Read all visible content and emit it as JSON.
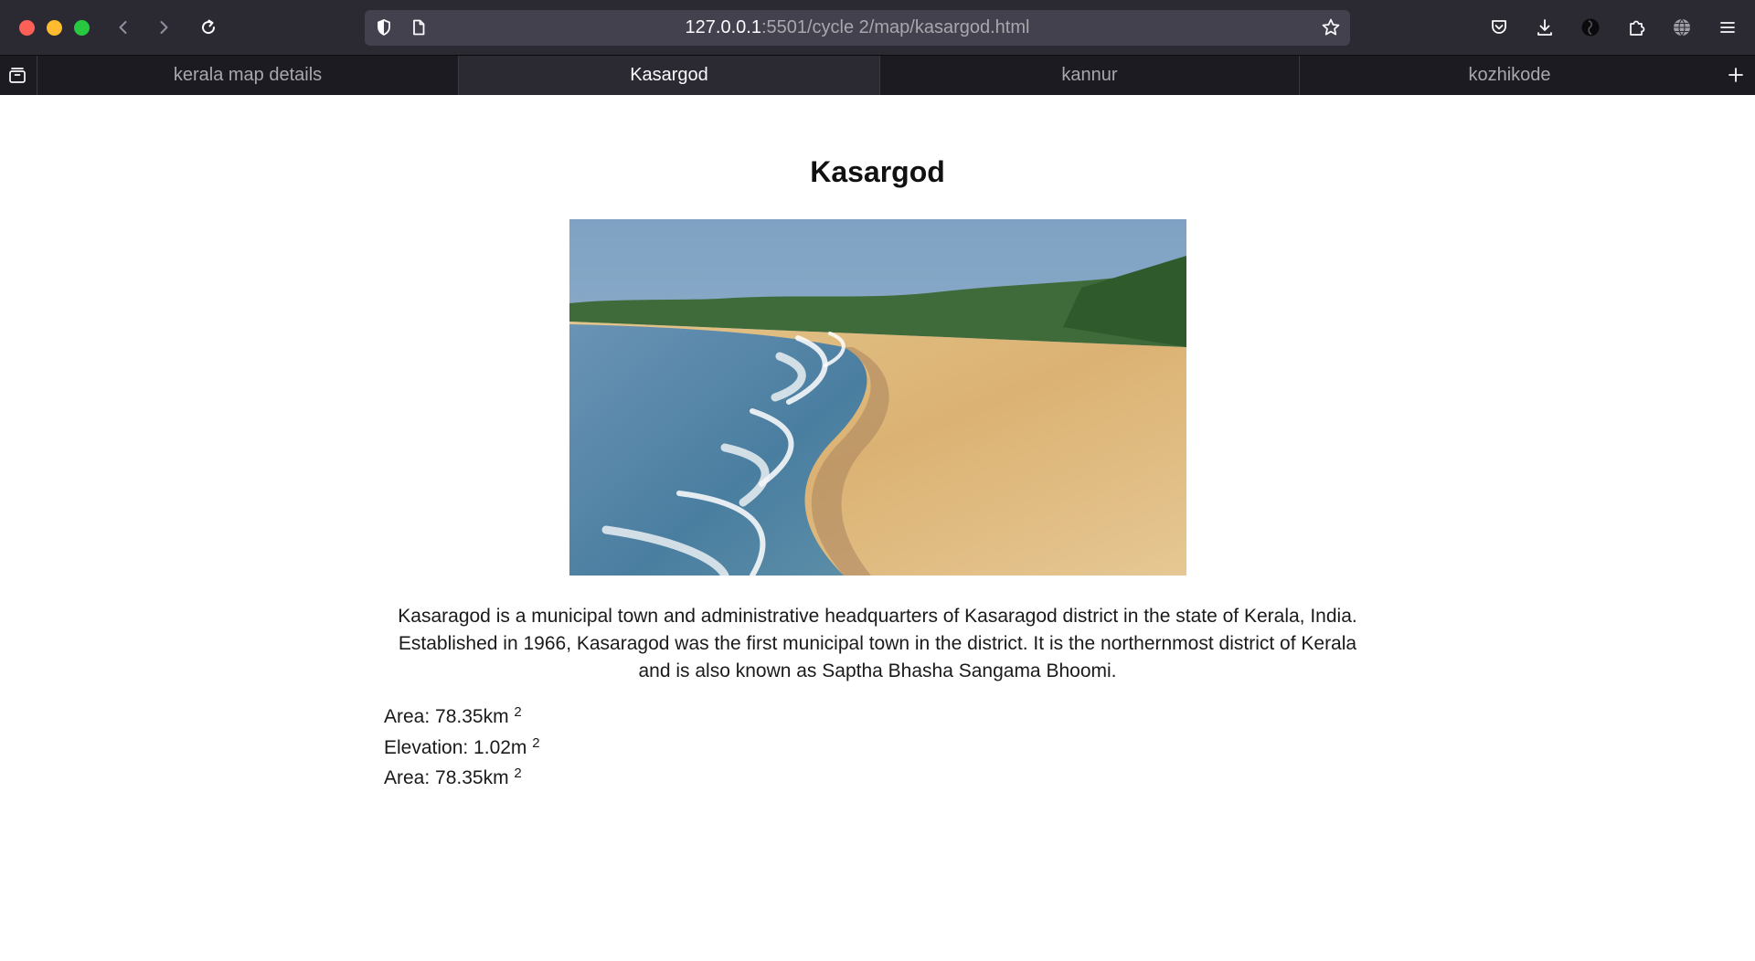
{
  "browser": {
    "url_host": "127.0.0.1",
    "url_path": ":5501/cycle 2/map/kasargod.html",
    "tabs": [
      {
        "label": "kerala map details",
        "active": false
      },
      {
        "label": "Kasargod",
        "active": true
      },
      {
        "label": "kannur",
        "active": false
      },
      {
        "label": "kozhikode",
        "active": false
      }
    ],
    "icons": [
      "back-arrow-icon",
      "forward-arrow-icon",
      "reload-icon",
      "tracking-shield-icon",
      "page-icon",
      "bookmark-star-icon",
      "pocket-icon",
      "download-icon",
      "account-icon",
      "extensions-icon",
      "globe-icon",
      "menu-icon",
      "tab-overview-icon",
      "new-tab-plus-icon"
    ]
  },
  "page": {
    "title": "Kasargod",
    "description": "Kasaragod is a municipal town and administrative headquarters of Kasaragod district in the state of Kerala, India. Established in 1966, Kasaragod was the first municipal town in the district. It is the northernmost district of Kerala and is also known as Saptha Bhasha Sangama Bhoomi.",
    "facts": [
      {
        "text": "Area: 78.35km",
        "sup": "2"
      },
      {
        "text": "Elevation: 1.02m",
        "sup": "2"
      },
      {
        "text": "Area: 78.35km",
        "sup": "2"
      }
    ]
  },
  "colors": {
    "toolbar_bg": "#2b2a33",
    "tabstrip_bg": "#1c1b22",
    "urlbar_bg": "#42414d",
    "close": "#fe5f57",
    "minimize": "#febc2e",
    "maximize": "#28c840"
  }
}
